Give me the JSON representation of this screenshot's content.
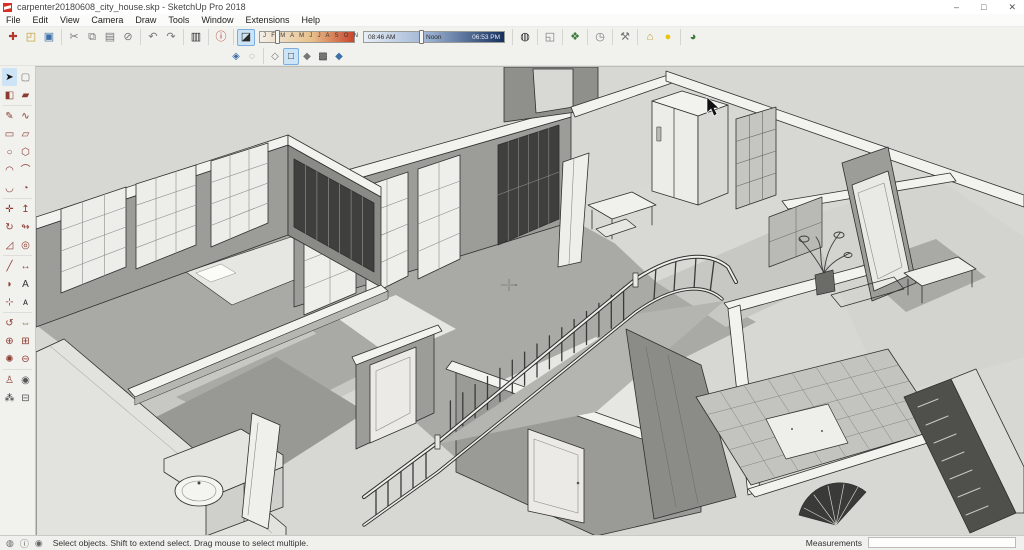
{
  "window": {
    "title": "carpenter20180608_city_house.skp - SketchUp Pro 2018",
    "controls": {
      "minimize": "–",
      "maximize": "□",
      "close": "✕"
    }
  },
  "menu": {
    "items": [
      "File",
      "Edit",
      "View",
      "Camera",
      "Draw",
      "Tools",
      "Window",
      "Extensions",
      "Help"
    ]
  },
  "toolbar": {
    "standard": [
      {
        "name": "new",
        "glyph": "✚"
      },
      {
        "name": "open",
        "glyph": "◰"
      },
      {
        "name": "save",
        "glyph": "▣"
      },
      {
        "name": "cut",
        "glyph": "✂"
      },
      {
        "name": "copy",
        "glyph": "⧉"
      },
      {
        "name": "paste",
        "glyph": "▤"
      },
      {
        "name": "erase",
        "glyph": "⊘"
      },
      {
        "name": "undo",
        "glyph": "↶"
      },
      {
        "name": "redo",
        "glyph": "↷"
      },
      {
        "name": "print",
        "glyph": "▥"
      },
      {
        "name": "model-info",
        "glyph": "ⓘ"
      }
    ],
    "shadow": {
      "toggle_glyph": "◪",
      "months_label": "J F M A M J J A S O N D",
      "sunrise_time": "08:46 AM",
      "noon_label": "Noon",
      "sunset_time": "06:53 PM"
    },
    "extras": [
      {
        "name": "add-location",
        "glyph": "◍"
      },
      {
        "name": "share-model",
        "glyph": "◱"
      },
      {
        "name": "extension-warehouse",
        "glyph": "❖"
      },
      {
        "name": "clock",
        "glyph": "◷"
      },
      {
        "name": "wrench",
        "glyph": "⚒"
      },
      {
        "name": "3d-warehouse",
        "glyph": "⌂"
      },
      {
        "name": "lightbulb",
        "glyph": "●"
      },
      {
        "name": "sketchup-help",
        "glyph": "◕"
      }
    ],
    "styles": [
      {
        "name": "x-ray",
        "glyph": "◈"
      },
      {
        "name": "back-edges",
        "glyph": "◌"
      },
      {
        "name": "wireframe",
        "glyph": "◇"
      },
      {
        "name": "hidden-line",
        "glyph": "□"
      },
      {
        "name": "shaded",
        "glyph": "◆"
      },
      {
        "name": "shaded-with-textures",
        "glyph": "▩"
      },
      {
        "name": "monochrome",
        "glyph": "◆"
      }
    ]
  },
  "tools": {
    "large_tool_set": [
      {
        "name": "select",
        "glyph": "➤"
      },
      {
        "name": "make-component",
        "glyph": "▢"
      },
      {
        "name": "paint-bucket",
        "glyph": "◧"
      },
      {
        "name": "eraser",
        "glyph": "▰"
      },
      {
        "name": "line",
        "glyph": "✎"
      },
      {
        "name": "freehand",
        "glyph": "∿"
      },
      {
        "name": "rectangle",
        "glyph": "▭"
      },
      {
        "name": "rotated-rectangle",
        "glyph": "▱"
      },
      {
        "name": "circle",
        "glyph": "○"
      },
      {
        "name": "polygon",
        "glyph": "⬡"
      },
      {
        "name": "arc",
        "glyph": "◠"
      },
      {
        "name": "two-point-arc",
        "glyph": "⌒"
      },
      {
        "name": "three-point-arc",
        "glyph": "◡"
      },
      {
        "name": "pie",
        "glyph": "◔"
      },
      {
        "name": "move",
        "glyph": "✛"
      },
      {
        "name": "push-pull",
        "glyph": "↥"
      },
      {
        "name": "rotate",
        "glyph": "↻"
      },
      {
        "name": "follow-me",
        "glyph": "↬"
      },
      {
        "name": "scale",
        "glyph": "◿"
      },
      {
        "name": "offset",
        "glyph": "◎"
      },
      {
        "name": "tape-measure",
        "glyph": "╱"
      },
      {
        "name": "dimension",
        "glyph": "↔"
      },
      {
        "name": "protractor",
        "glyph": "◗"
      },
      {
        "name": "text",
        "glyph": "A"
      },
      {
        "name": "axes",
        "glyph": "⊹"
      },
      {
        "name": "3d-text",
        "glyph": "ᴀ"
      },
      {
        "name": "orbit",
        "glyph": "↺"
      },
      {
        "name": "pan",
        "glyph": "⇔"
      },
      {
        "name": "zoom",
        "glyph": "⊕"
      },
      {
        "name": "zoom-window",
        "glyph": "⊞"
      },
      {
        "name": "zoom-extents",
        "glyph": "✺"
      },
      {
        "name": "zoom-previous",
        "glyph": "⊖"
      },
      {
        "name": "position-camera",
        "glyph": "♙"
      },
      {
        "name": "look-around",
        "glyph": "◉"
      },
      {
        "name": "walk",
        "glyph": "⁂"
      },
      {
        "name": "section-plane",
        "glyph": "⊟"
      }
    ]
  },
  "statusbar": {
    "icons": [
      {
        "name": "geolocation-status",
        "glyph": "◍"
      },
      {
        "name": "help-status",
        "glyph": "ⓘ"
      },
      {
        "name": "credits-status",
        "glyph": "◉"
      }
    ],
    "hint": "Select objects. Shift to extend select. Drag mouse to select multiple.",
    "measurements_label": "Measurements",
    "measurements_value": ""
  },
  "colors": {
    "accent_selected": "#cde3f6",
    "viewport_bg": "#d7d7d3",
    "edge": "#2f2f2d",
    "wall_top": "#f2f2ee",
    "face_light": "#e6e6e2",
    "face_mid": "#c7c7c3",
    "face_dark": "#9c9c99",
    "shadow": "#a9a9a5",
    "lattice_dark": "#3f3f3d",
    "slider_sun_start": "#e8eef6",
    "slider_sun_end": "#16305e",
    "slider_season_start": "#f2efe8",
    "slider_season_end": "#c8452c"
  }
}
